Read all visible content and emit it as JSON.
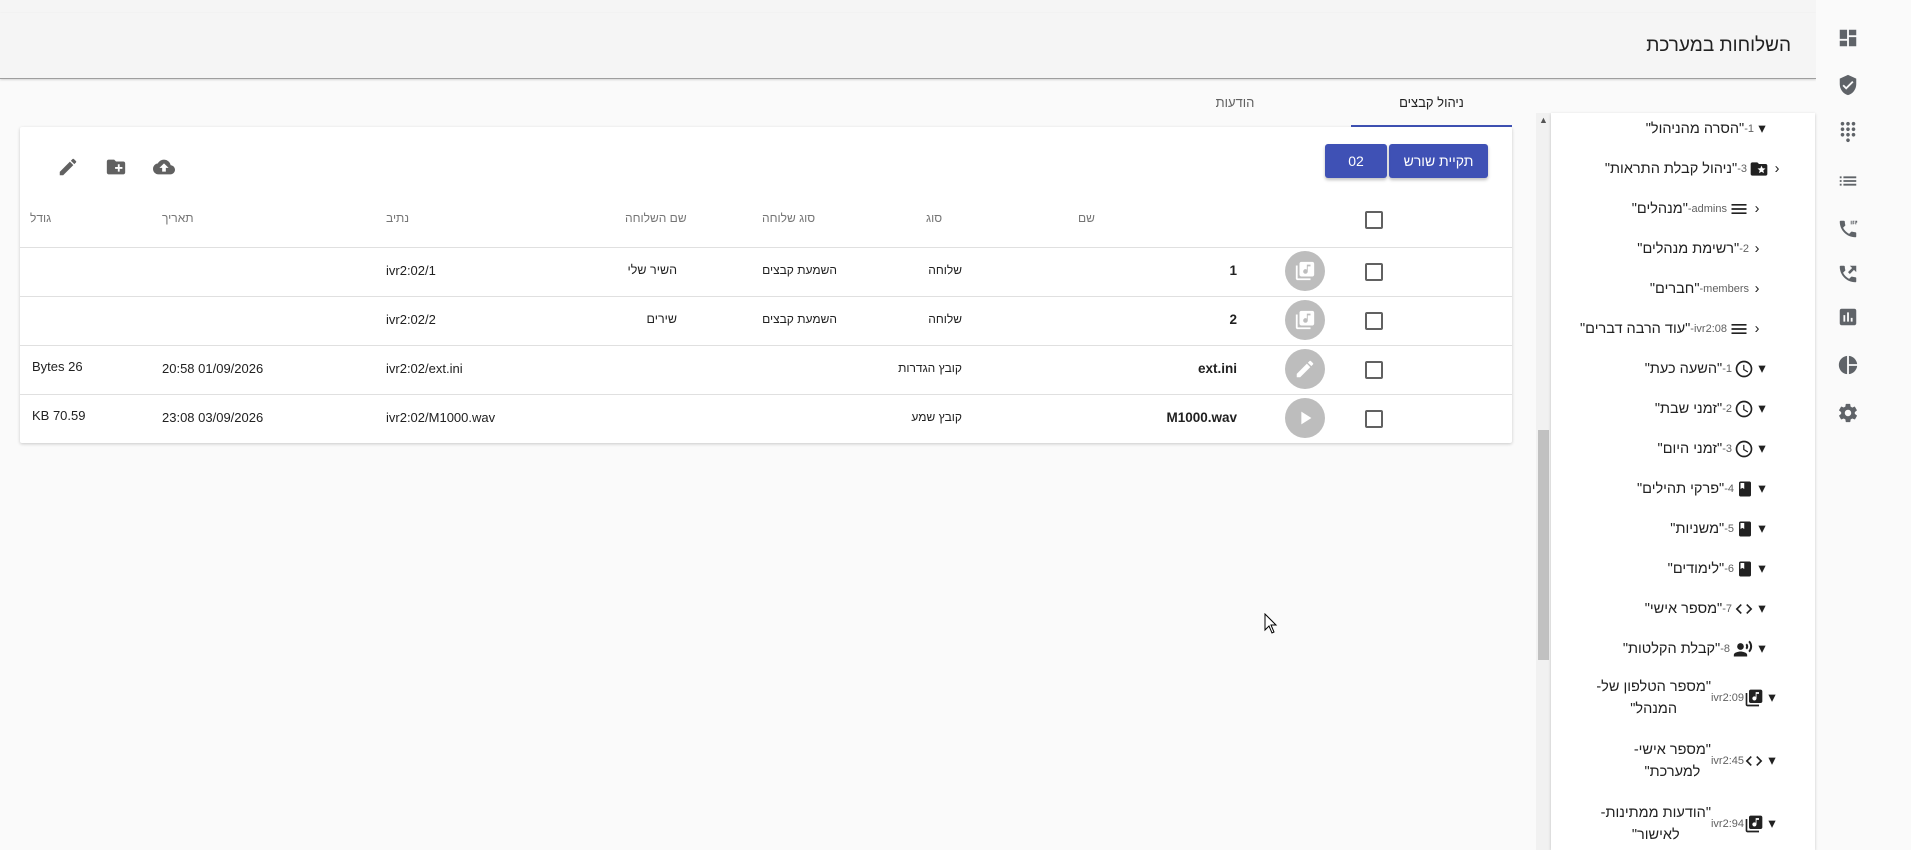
{
  "header": {
    "title": "השלוחות במערכת"
  },
  "rail": {
    "icons": [
      "dashboard-icon",
      "shield-icon",
      "dialpad-icon",
      "list-icon",
      "sip-phone-icon",
      "phone-forward-icon",
      "chart-icon",
      "pie-chart-icon",
      "settings-icon"
    ]
  },
  "tree": {
    "nodes": [
      {
        "label": "\"הסרה מהניהול\"",
        "sub": "1-",
        "icon": "",
        "arrow": "▾"
      },
      {
        "label": "\"ניהול קבלת התראות\"",
        "sub": "3-",
        "icon": "folder-star-icon",
        "arrow": "‹"
      },
      {
        "label": "\"מנהלים\"",
        "sub": "admins-",
        "icon": "menu-icon",
        "arrow": "‹"
      },
      {
        "label": "\"רשימת מנהלים\"",
        "sub": "2-",
        "icon": "",
        "arrow": "‹"
      },
      {
        "label": "\"חברים\"",
        "sub": "members-",
        "icon": "",
        "arrow": "‹"
      },
      {
        "label": "\"עוד הרבה דברים\"",
        "sub": "ivr2:08-",
        "icon": "menu-icon",
        "arrow": "‹"
      },
      {
        "label": "\"השעה כעת\"",
        "sub": "1-",
        "icon": "clock-icon",
        "arrow": "▾"
      },
      {
        "label": "\"זמני שבת\"",
        "sub": "2-",
        "icon": "clock-icon",
        "arrow": "▾"
      },
      {
        "label": "\"זמני היום\"",
        "sub": "3-",
        "icon": "clock-icon",
        "arrow": "▾"
      },
      {
        "label": "\"פרקי תהילים\"",
        "sub": "4-",
        "icon": "book-icon",
        "arrow": "▾"
      },
      {
        "label": "\"משניות\"",
        "sub": "5-",
        "icon": "book-icon",
        "arrow": "▾"
      },
      {
        "label": "\"לימודים\"",
        "sub": "6-",
        "icon": "book-icon",
        "arrow": "▾"
      },
      {
        "label": "\"מספר אישי\"",
        "sub": "7-",
        "icon": "code-icon",
        "arrow": "▾"
      },
      {
        "label": "\"קבלת הקלטות\"",
        "sub": "8-",
        "icon": "record-voice-icon",
        "arrow": "▾"
      }
    ],
    "multi": [
      {
        "line1": "\"מספר הטלפון של-",
        "line2": "המנהל\"",
        "sub": "ivr2:09",
        "icon": "library-music-icon",
        "arrow": "▾"
      },
      {
        "line1": "\"מספר אישי-",
        "line2": "למערכת\"",
        "sub": "ivr2:45",
        "icon": "code-icon",
        "arrow": "▾"
      },
      {
        "line1": "\"הודעות ממתינות-",
        "line2": "לאישור\"",
        "sub": "ivr2:94",
        "icon": "library-music-icon",
        "arrow": "▾"
      }
    ]
  },
  "tabs": [
    {
      "label": "ניהול קבצים",
      "active": true
    },
    {
      "label": "הודעות",
      "active": false
    }
  ],
  "toolbar": {
    "root_label": "תקיית שורש",
    "folder_label": "02"
  },
  "table": {
    "columns": {
      "name": "שם",
      "type": "סוג",
      "ext_type": "סוג שלוחה",
      "ext_name": "שם השלוחה",
      "path": "נתיב",
      "date": "תאריך",
      "size": "גודל"
    },
    "rows": [
      {
        "icon": "music-file-icon",
        "name": "1",
        "type": "שלוחה",
        "ext_type": "השמעת קבצים",
        "ext_name": "השיר שלי",
        "path": "ivr2:02/1",
        "date": "",
        "size": ""
      },
      {
        "icon": "music-file-icon",
        "name": "2",
        "type": "שלוחה",
        "ext_type": "השמעת קבצים",
        "ext_name": "שירים",
        "path": "ivr2:02/2",
        "date": "",
        "size": ""
      },
      {
        "icon": "edit-icon",
        "name": "ext.ini",
        "type": "קובץ הגדרות",
        "ext_type": "",
        "ext_name": "",
        "path": "ivr2:02/ext.ini",
        "date": "20:58 01/09/2026",
        "size": "Bytes 26"
      },
      {
        "icon": "play-icon",
        "name": "M1000.wav",
        "type": "קובץ שמע",
        "ext_type": "",
        "ext_name": "",
        "path": "ivr2:02/M1000.wav",
        "date": "23:08 03/09/2026",
        "size": "KB 70.59"
      }
    ]
  }
}
